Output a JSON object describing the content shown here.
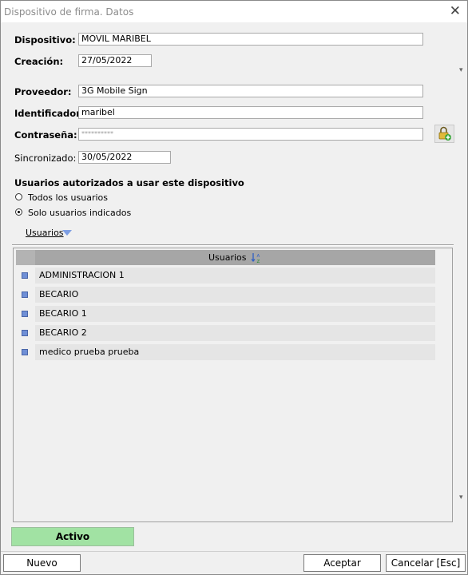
{
  "window": {
    "title": "Dispositivo de firma. Datos",
    "close": "✕"
  },
  "form": {
    "dispositivo": {
      "label": "Dispositivo:",
      "value": "MOVIL MARIBEL"
    },
    "creacion": {
      "label": "Creación:",
      "value": "27/05/2022"
    },
    "proveedor": {
      "label": "Proveedor:",
      "value": "3G Mobile Sign"
    },
    "identificador": {
      "label": "Identificador:",
      "value": "maribel"
    },
    "contrasena": {
      "label": "Contraseña:",
      "value": "**********"
    },
    "sincronizado": {
      "label": "Sincronizado:",
      "value": "30/05/2022"
    }
  },
  "usuarios_section": {
    "heading": "Usuarios autorizados a usar este dispositivo",
    "options": [
      {
        "label": "Todos los usuarios",
        "selected": false
      },
      {
        "label": "Solo usuarios indicados",
        "selected": true
      }
    ],
    "menu_label": "Usuarios"
  },
  "grid": {
    "column_header": "Usuarios",
    "rows": [
      "ADMINISTRACION 1",
      "BECARIO",
      "BECARIO 1",
      "BECARIO 2",
      "medico prueba prueba"
    ]
  },
  "status": {
    "label": "Activo",
    "color": "#a1e2a3"
  },
  "buttons": {
    "nuevo": "Nuevo",
    "aceptar": "Aceptar",
    "cancelar": "Cancelar [Esc]"
  }
}
